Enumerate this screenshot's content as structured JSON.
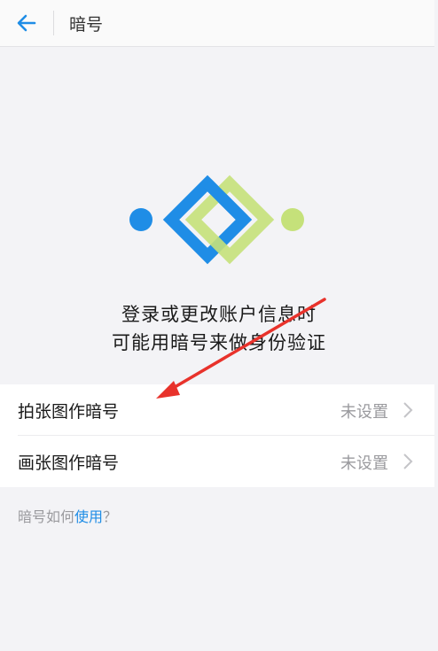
{
  "header": {
    "title": "暗号",
    "back_icon": "arrow-left-icon"
  },
  "colors": {
    "accent_blue": "#1f8de6",
    "accent_green": "#c5e17a",
    "annotation_red": "#e8322b"
  },
  "intro": {
    "line1": "登录或更改账户信息时",
    "line2": "可能用暗号来做身份验证"
  },
  "options": [
    {
      "label": "拍张图作暗号",
      "status": "未设置"
    },
    {
      "label": "画张图作暗号",
      "status": "未设置"
    }
  ],
  "help": {
    "prefix": "暗号如何",
    "link": "使用",
    "suffix": "？"
  }
}
